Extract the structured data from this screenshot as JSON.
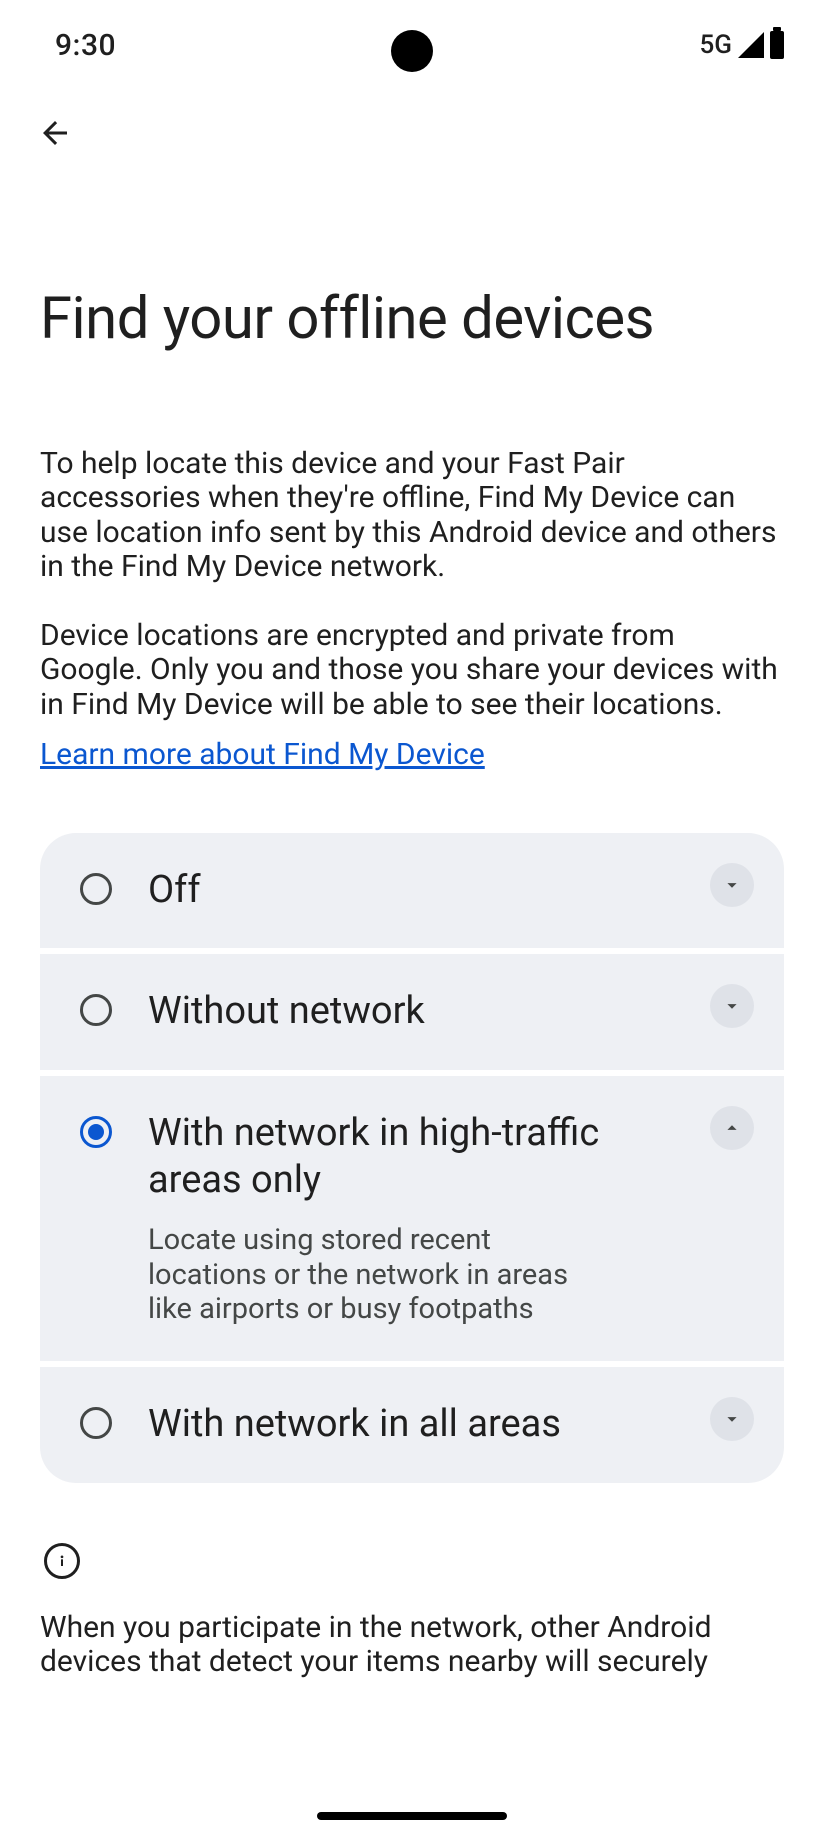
{
  "statusbar": {
    "time": "9:30",
    "network_label": "5G"
  },
  "page": {
    "title": "Find your offline devices",
    "intro_p1": "To help locate this device and your Fast Pair accessories when they're offline, Find My Device can use location info sent by this Android device and others in the Find My Device network.",
    "intro_p2": "Device locations are encrypted and private from Google. Only you and those you share your devices with in Find My Device will be able to see their locations.",
    "learn_more_label": "Learn more about Find My Device"
  },
  "options": [
    {
      "label": "Off",
      "selected": false,
      "expanded": false,
      "description": ""
    },
    {
      "label": "Without network",
      "selected": false,
      "expanded": false,
      "description": ""
    },
    {
      "label": "With network in high-traffic areas only",
      "selected": true,
      "expanded": true,
      "description": "Locate using stored recent locations or the network in areas like airports or busy footpaths"
    },
    {
      "label": "With network in all areas",
      "selected": false,
      "expanded": false,
      "description": ""
    }
  ],
  "info": {
    "text": "When you participate in the network, other Android devices that detect your items nearby will securely"
  }
}
